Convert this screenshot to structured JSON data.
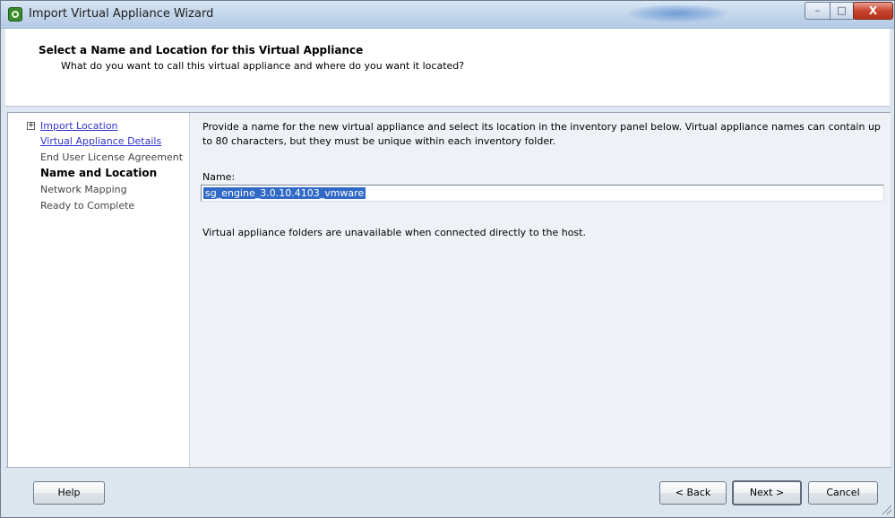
{
  "window": {
    "title": "Import Virtual Appliance Wizard",
    "controls": {
      "minimize": "–",
      "maximize": "□",
      "close": "X"
    }
  },
  "header": {
    "title": "Select a Name and Location for this Virtual Appliance",
    "subtitle": "What do you want to call this virtual appliance and where do you want it located?"
  },
  "nav": {
    "expander": "+",
    "items": [
      {
        "label": "Import Location",
        "state": "link"
      },
      {
        "label": "Virtual Appliance Details",
        "state": "link"
      },
      {
        "label": "End User License Agreement",
        "state": "normal"
      },
      {
        "label": "Name and Location",
        "state": "current"
      },
      {
        "label": "Network Mapping",
        "state": "normal"
      },
      {
        "label": "Ready to Complete",
        "state": "normal"
      }
    ]
  },
  "main": {
    "description": "Provide a name for the new virtual appliance and select its location in the inventory panel below. Virtual appliance names can contain up to 80 characters, but they must be unique within each inventory folder.",
    "name_label": "Name:",
    "name_value": "sg_engine_3.0.10.4103_vmware",
    "folder_note": "Virtual appliance folders are unavailable when connected directly to the host."
  },
  "footer": {
    "help": "Help",
    "back": "< Back",
    "next": "Next >",
    "cancel": "Cancel"
  },
  "colors": {
    "link": "#3333cc",
    "selection": "#3169c6",
    "close_button": "#c7442e",
    "title_bar": "#c4d7ec"
  }
}
